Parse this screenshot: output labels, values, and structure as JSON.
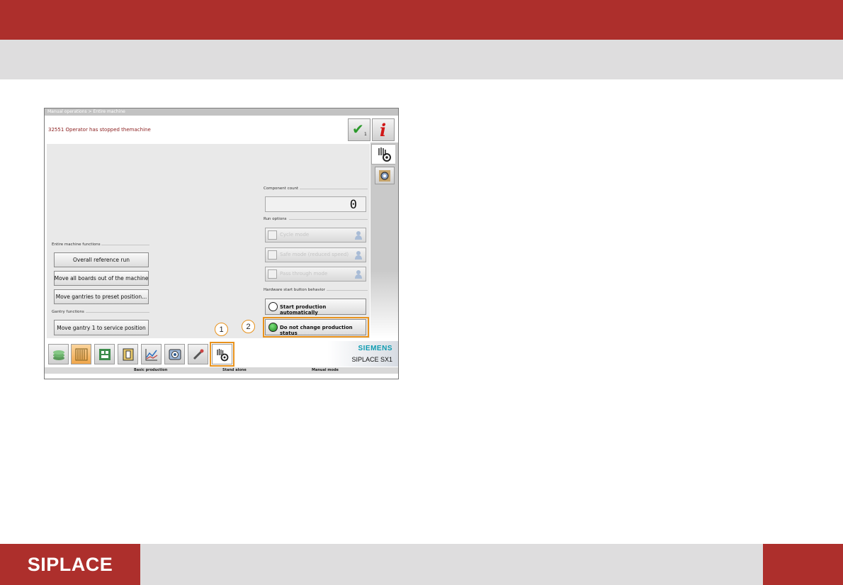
{
  "footer": {
    "logo": "SIPLACE"
  },
  "screen": {
    "breadcrumb": "Manual operations > Entire machine",
    "message": "32551 Operator has stopped themachine",
    "ack_count": "1",
    "info_glyph": "i",
    "entire_machine": {
      "title": "Entire machine functions",
      "buttons": [
        "Overall reference run",
        "Move all boards out of the machine",
        "Move gantries to preset position..."
      ]
    },
    "gantry": {
      "title": "Gantry functions",
      "buttons": [
        "Move gantry 1 to service position"
      ]
    },
    "component_count": {
      "title": "Component count",
      "value": "0"
    },
    "run_options": {
      "title": "Run options",
      "items": [
        "Cycle mode",
        "Safe mode (reduced speed)",
        "Pass through mode"
      ]
    },
    "hardware_start": {
      "title": "Hardware start button behavior",
      "options": [
        {
          "label": "Start production automatically",
          "selected": false
        },
        {
          "label": "Do not change production status",
          "selected": true
        }
      ]
    },
    "callouts": [
      "1",
      "2"
    ],
    "brand": {
      "name": "SIEMENS",
      "model": "SIPLACE SX1"
    },
    "taskbar_icons": [
      "production-icon",
      "setup-icon",
      "board-icon",
      "feeder-icon",
      "chart-icon",
      "camera-icon",
      "tools-icon",
      "manual-operations-icon"
    ],
    "status": [
      "Basic production",
      "Stand alone",
      "Manual mode"
    ]
  },
  "colors": {
    "brand_red": "#ad2f2c",
    "highlight_orange": "#e8921c",
    "siemens_teal": "#0e9bb1"
  }
}
